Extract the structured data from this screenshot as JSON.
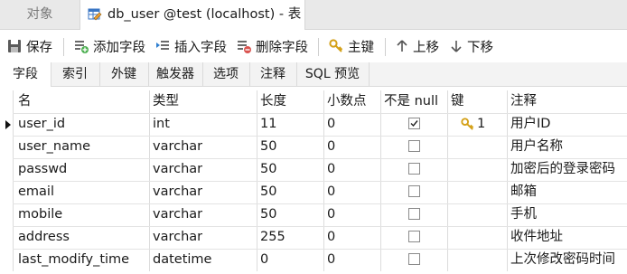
{
  "window_tabs": {
    "objects_label": "对象",
    "active_label": "db_user @test (localhost) - 表"
  },
  "toolbar": {
    "save": "保存",
    "add_field": "添加字段",
    "insert_field": "插入字段",
    "delete_field": "删除字段",
    "primary_key": "主键",
    "move_up": "上移",
    "move_down": "下移"
  },
  "subtabs": [
    "字段",
    "索引",
    "外键",
    "触发器",
    "选项",
    "注释",
    "SQL 预览"
  ],
  "columns": [
    "名",
    "类型",
    "长度",
    "小数点",
    "不是 null",
    "键",
    "注释"
  ],
  "rows": [
    {
      "name": "user_id",
      "type": "int",
      "length": "11",
      "decimals": "0",
      "not_null": true,
      "key": "1",
      "comment": "用户ID"
    },
    {
      "name": "user_name",
      "type": "varchar",
      "length": "50",
      "decimals": "0",
      "not_null": false,
      "key": "",
      "comment": "用户名称"
    },
    {
      "name": "passwd",
      "type": "varchar",
      "length": "50",
      "decimals": "0",
      "not_null": false,
      "key": "",
      "comment": "加密后的登录密码"
    },
    {
      "name": "email",
      "type": "varchar",
      "length": "50",
      "decimals": "0",
      "not_null": false,
      "key": "",
      "comment": "邮箱"
    },
    {
      "name": "mobile",
      "type": "varchar",
      "length": "50",
      "decimals": "0",
      "not_null": false,
      "key": "",
      "comment": "手机"
    },
    {
      "name": "address",
      "type": "varchar",
      "length": "255",
      "decimals": "0",
      "not_null": false,
      "key": "",
      "comment": "收件地址"
    },
    {
      "name": "last_modify_time",
      "type": "datetime",
      "length": "0",
      "decimals": "0",
      "not_null": false,
      "key": "",
      "comment": "上次修改密码时间"
    }
  ],
  "selected_row": 0,
  "icons": {
    "save": "save-icon",
    "add": "add-field-icon",
    "insert": "insert-field-icon",
    "delete": "delete-field-icon",
    "key": "key-icon",
    "up": "arrow-up-icon",
    "down": "arrow-down-icon"
  },
  "colors": {
    "key_gold": "#d4a017",
    "delete_red": "#d9534f",
    "add_green": "#4caf50"
  }
}
